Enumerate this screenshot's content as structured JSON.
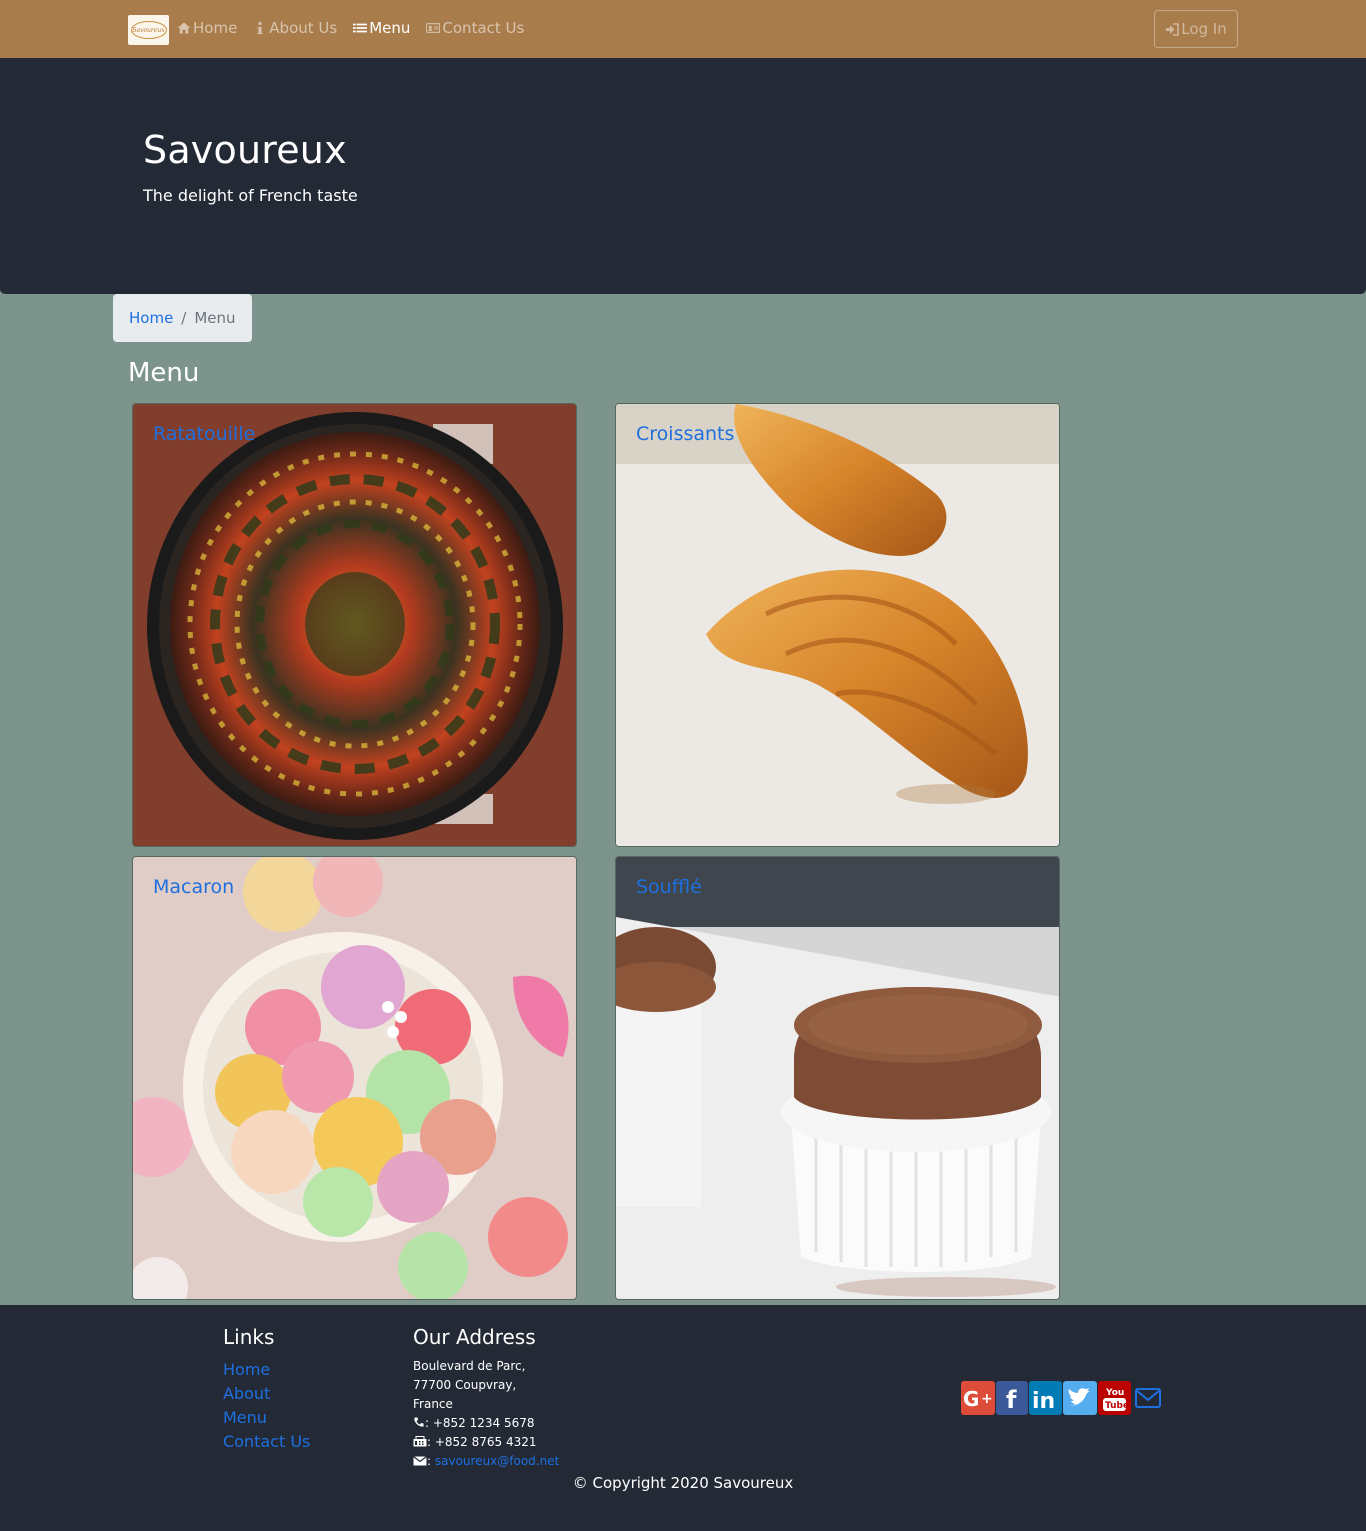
{
  "nav": {
    "brand_text": "Savoureux",
    "items": [
      {
        "label": "Home",
        "icon": "home-icon"
      },
      {
        "label": "About Us",
        "icon": "info-icon"
      },
      {
        "label": "Menu",
        "icon": "list-icon"
      },
      {
        "label": "Contact Us",
        "icon": "address-card-icon"
      }
    ],
    "login_label": "Log In"
  },
  "jumbotron": {
    "title": "Savoureux",
    "subtitle": "The delight of French taste"
  },
  "breadcrumb": {
    "home": "Home",
    "separator": "/",
    "current": "Menu"
  },
  "page_heading": "Menu",
  "dishes": [
    {
      "name": "Ratatouille"
    },
    {
      "name": "Croissants"
    },
    {
      "name": "Macaron"
    },
    {
      "name": "Soufflé"
    }
  ],
  "footer": {
    "links_heading": "Links",
    "links": [
      "Home",
      "About",
      "Menu",
      "Contact Us"
    ],
    "address_heading": "Our Address",
    "address_lines": [
      "Boulevard de Parc,",
      "77700 Coupvray,",
      "France"
    ],
    "phone": ": +852 1234 5678",
    "fax": ": +852 8765 4321",
    "email": "savoureux@food.net",
    "social": [
      "google-plus-icon",
      "facebook-icon",
      "linkedin-icon",
      "twitter-icon",
      "youtube-icon",
      "envelope-icon"
    ],
    "copyright": "© Copyright 2020 Savoureux"
  },
  "colors": {
    "navbar": "#a87c4b",
    "jumbotron": "#232a36",
    "page_background": "#7c948b",
    "link": "#1e6fe0"
  }
}
